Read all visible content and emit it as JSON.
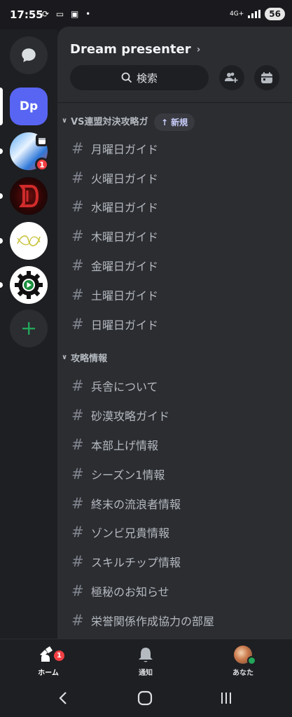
{
  "status_bar": {
    "time": "17:55",
    "left_icons": "⟳ ▭ ▣ •",
    "network": "4G+",
    "battery": "56"
  },
  "server_rail": {
    "dp_label": "Dp",
    "game1_badge": "1"
  },
  "header": {
    "server_name": "Dream presenter",
    "search_label": "検索"
  },
  "new_pill": {
    "label": "新規"
  },
  "categories": [
    {
      "name": "VS連盟対決攻略ガ",
      "channels": [
        "月曜日ガイド",
        "火曜日ガイド",
        "水曜日ガイド",
        "木曜日ガイド",
        "金曜日ガイド",
        "土曜日ガイド",
        "日曜日ガイド"
      ]
    },
    {
      "name": "攻略情報",
      "channels": [
        "兵舎について",
        "砂漠攻略ガイド",
        "本部上げ情報",
        "シーズン1情報",
        "終末の流浪者情報",
        "ゾンビ兄貴情報",
        "スキルチップ情報",
        "極秘のお知らせ",
        "栄誉関係作成協力の部屋"
      ]
    }
  ],
  "bottom_nav": {
    "home": "ホーム",
    "home_badge": "1",
    "notifications": "通知",
    "you": "あなた"
  },
  "colors": {
    "accent": "#5865f2",
    "badge": "#f23f43",
    "online": "#23a55a",
    "add_server": "#23a55a"
  }
}
